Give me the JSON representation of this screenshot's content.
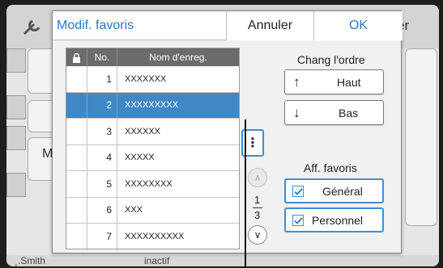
{
  "background": {
    "side_label_a": "M",
    "side_label_b": "M",
    "tab_label": "er",
    "footer_left": "¸.Smith",
    "footer_mid": "inactif"
  },
  "dialog": {
    "title": "Modif. favoris",
    "cancel_label": "Annuler",
    "ok_label": "OK"
  },
  "table": {
    "columns": [
      "",
      "No.",
      "Nom d'enreg."
    ],
    "rows": [
      {
        "no": "1",
        "name": "XXXXXXX",
        "selected": false
      },
      {
        "no": "2",
        "name": "XXXXXXXXX",
        "selected": true
      },
      {
        "no": "3",
        "name": "XXXXXX",
        "selected": false
      },
      {
        "no": "4",
        "name": "XXXXX",
        "selected": false
      },
      {
        "no": "5",
        "name": "XXXXXXXX",
        "selected": false
      },
      {
        "no": "6",
        "name": "XXX",
        "selected": false
      },
      {
        "no": "7",
        "name": "XXXXXXXXXX",
        "selected": false
      }
    ]
  },
  "middle": {
    "more_glyph": "⋮",
    "page_current": "1",
    "page_total": "3",
    "up_glyph": "∧",
    "down_glyph": "∨"
  },
  "order": {
    "label": "Chang l'ordre",
    "up_label": "Haut",
    "up_glyph": "↑",
    "down_label": "Bas",
    "down_glyph": "↓"
  },
  "favorites": {
    "label": "Aff. favoris",
    "general_label": "Général",
    "general_checked": true,
    "personal_label": "Personnel",
    "personal_checked": true
  },
  "colors": {
    "accent": "#2b78c8",
    "selected_row": "#3f88c5",
    "header_dark": "#6b6b6b"
  }
}
